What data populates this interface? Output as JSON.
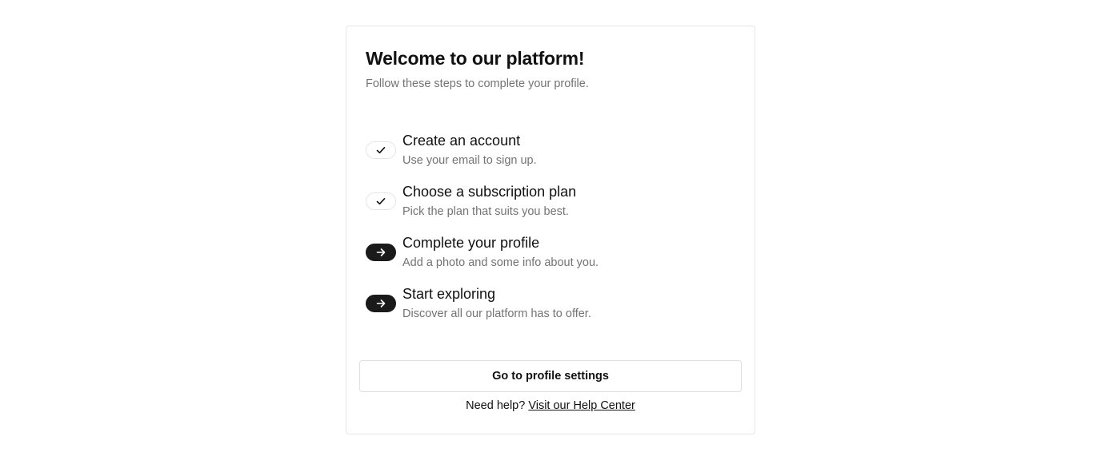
{
  "header": {
    "title": "Welcome to our platform!",
    "subtitle": "Follow these steps to complete your profile."
  },
  "steps": [
    {
      "title": "Create an account",
      "description": "Use your email to sign up.",
      "status": "completed",
      "icon": "check-icon"
    },
    {
      "title": "Choose a subscription plan",
      "description": "Pick the plan that suits you best.",
      "status": "completed",
      "icon": "check-icon"
    },
    {
      "title": "Complete your profile",
      "description": "Add a photo and some info about you.",
      "status": "pending",
      "icon": "arrow-right-icon"
    },
    {
      "title": "Start exploring",
      "description": "Discover all our platform has to offer.",
      "status": "pending",
      "icon": "arrow-right-icon"
    }
  ],
  "actions": {
    "primary_label": "Go to profile settings"
  },
  "help": {
    "prompt": "Need help?",
    "link_label": "Visit our Help Center"
  },
  "colors": {
    "text": "#111111",
    "muted": "#737373",
    "border": "#e5e5e5",
    "pending_badge": "#1a1a1a"
  }
}
